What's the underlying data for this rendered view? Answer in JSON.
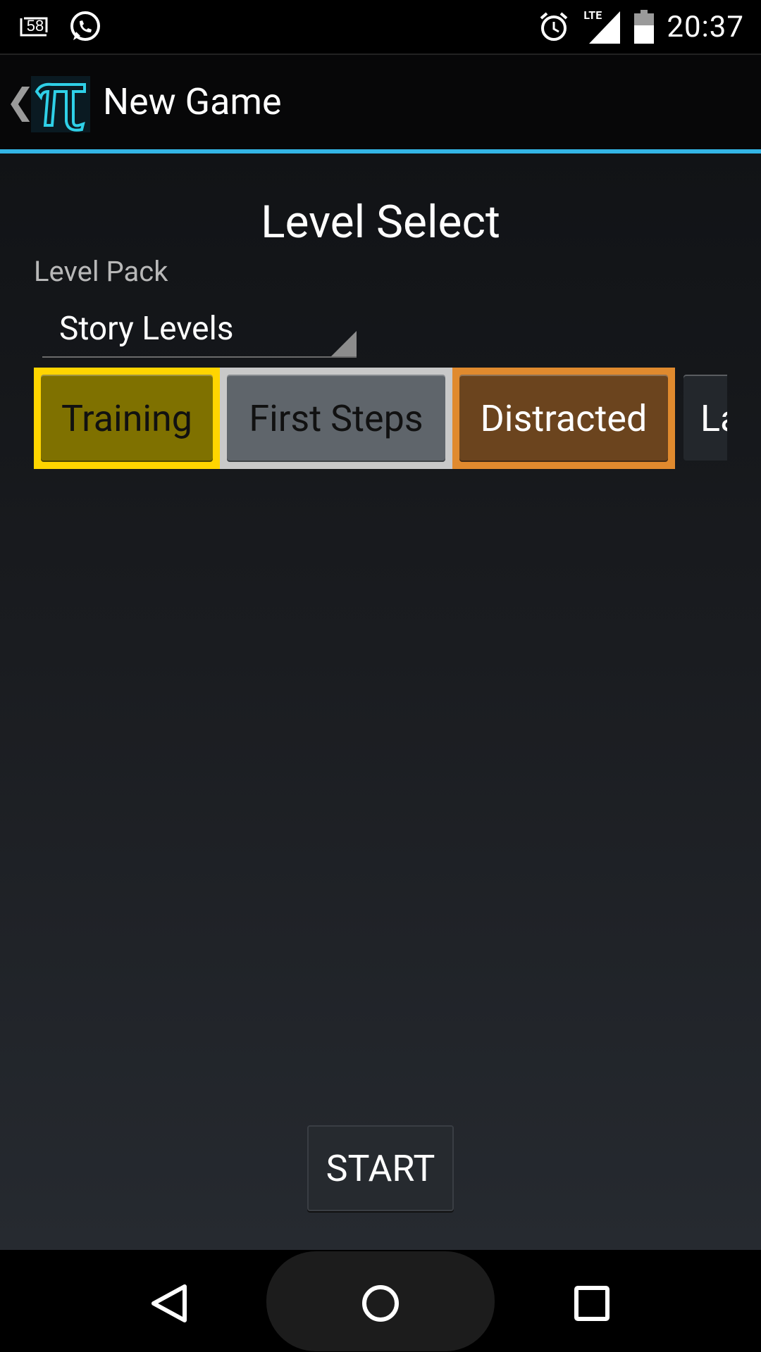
{
  "status_bar": {
    "notification_badge": "58",
    "time": "20:37",
    "network": "LTE",
    "icons": [
      "notification-count-icon",
      "whatsapp-icon",
      "alarm-icon",
      "lte-signal-icon",
      "battery-icon"
    ]
  },
  "app_bar": {
    "title": "New Game",
    "logo_icon": "pi-icon",
    "accent_color": "#33b5e5"
  },
  "main": {
    "heading": "Level Select",
    "level_pack_label": "Level Pack",
    "level_pack_value": "Story Levels",
    "levels": [
      {
        "label": "Training",
        "border_color": "#ffd500",
        "fill_color": "#7f7100"
      },
      {
        "label": "First Steps",
        "border_color": "#c9c9c9",
        "fill_color": "#5f656b"
      },
      {
        "label": "Distracted",
        "border_color": "#e08a2e",
        "fill_color": "#6b441e"
      },
      {
        "label": "La"
      }
    ],
    "start_label": "START"
  },
  "nav_bar": {
    "icons": [
      "back-triangle-icon",
      "home-circle-icon",
      "recents-square-icon"
    ]
  }
}
